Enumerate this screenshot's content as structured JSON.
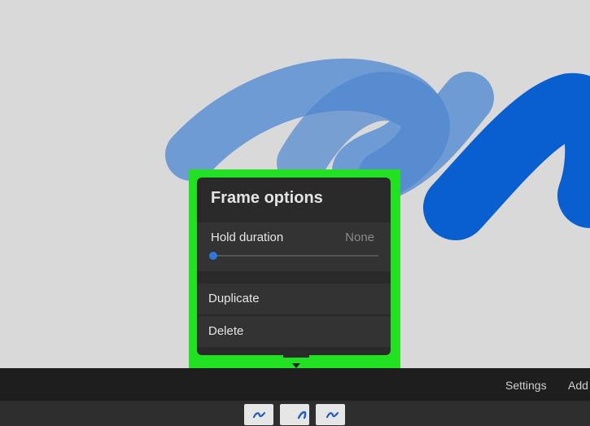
{
  "popover": {
    "title": "Frame options",
    "hold_duration": {
      "label": "Hold duration",
      "value": "None",
      "slider_fraction": 0
    },
    "actions": {
      "duplicate": "Duplicate",
      "delete": "Delete"
    }
  },
  "toolbar": {
    "settings_label": "Settings",
    "add_label": "Add"
  },
  "timeline": {
    "frame_count": 3
  },
  "colors": {
    "stroke_light": "#5b8fd2",
    "stroke_dark": "#0a5fd0",
    "highlight": "#22e022",
    "accent": "#2f76d8"
  }
}
